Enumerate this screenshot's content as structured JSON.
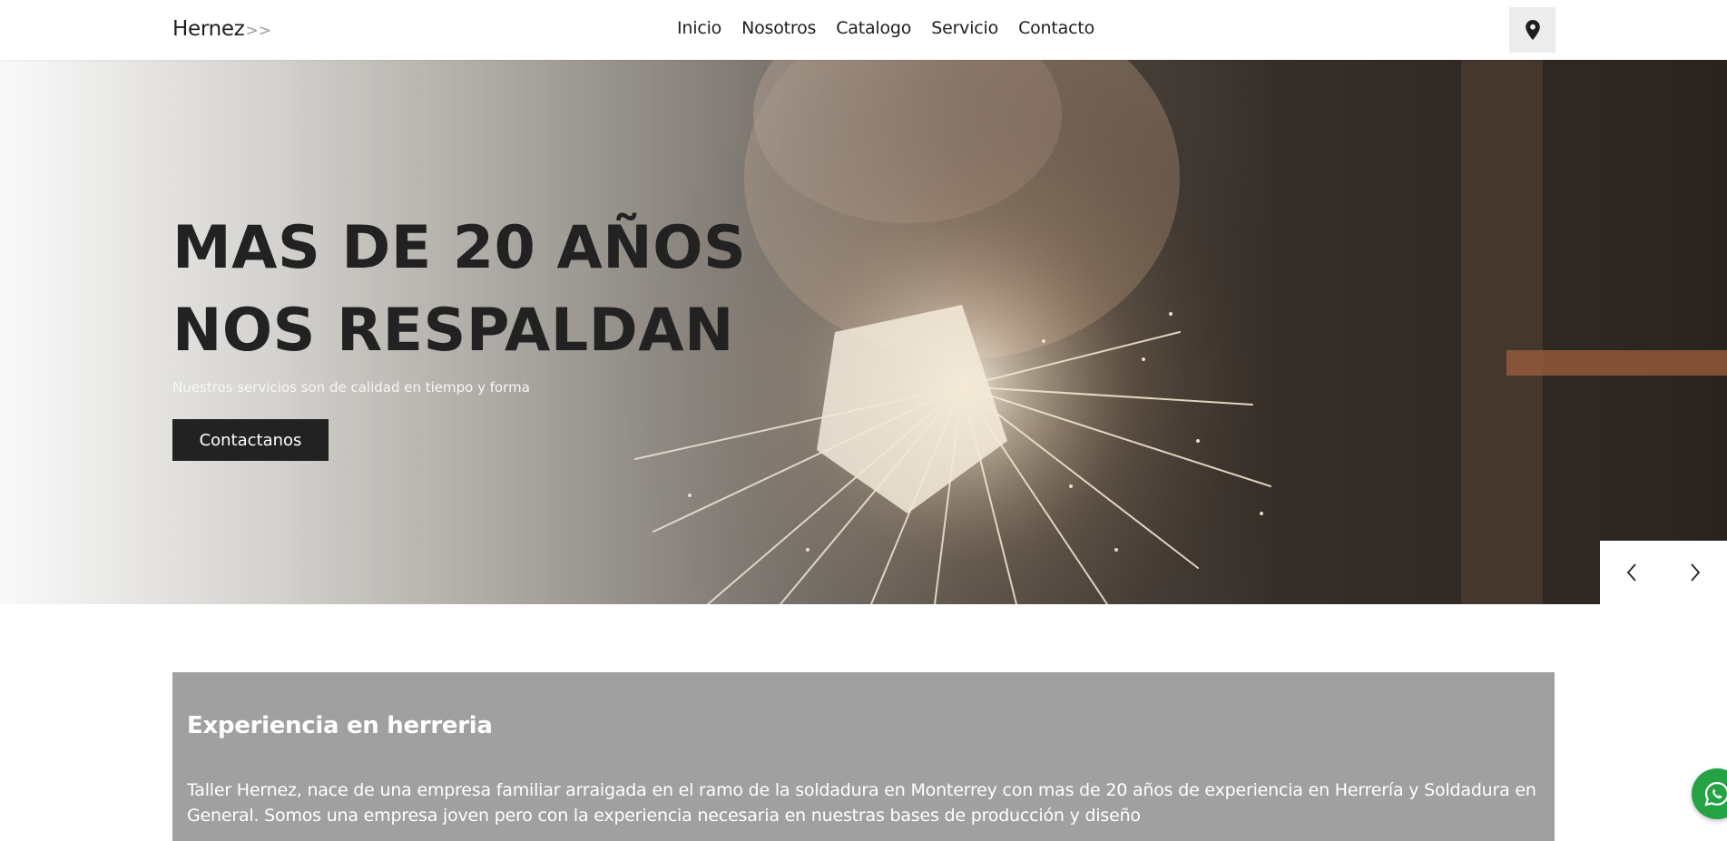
{
  "header": {
    "brand": "Hernez",
    "brand_suffix": ">>",
    "nav": [
      "Inicio",
      "Nosotros",
      "Catalogo",
      "Servicio",
      "Contacto"
    ],
    "location_icon": "map-pin-icon"
  },
  "hero": {
    "title_line1": "MAS DE 20 AÑOS",
    "title_line2": "NOS RESPALDAN",
    "subtitle": "Nuestros servicios son de calidad en tiempo y forma",
    "cta_label": "Contactanos",
    "prev_icon": "chevron-left-icon",
    "next_icon": "chevron-right-icon"
  },
  "about": {
    "title": "Experiencia en herreria",
    "text": "Taller Hernez, nace de una empresa familiar arraigada en el ramo de la soldadura en Monterrey con mas de 20 años de experiencia en Herrería y Soldadura en General. Somos una empresa joven pero con la experiencia necesaria en nuestras bases de producción y diseño"
  },
  "whatsapp": {
    "icon": "whatsapp-icon"
  },
  "colors": {
    "primary_dark": "#222222",
    "panel_gray": "#a0a0a0",
    "whatsapp_green": "#25a244",
    "location_bg": "#ececec"
  }
}
